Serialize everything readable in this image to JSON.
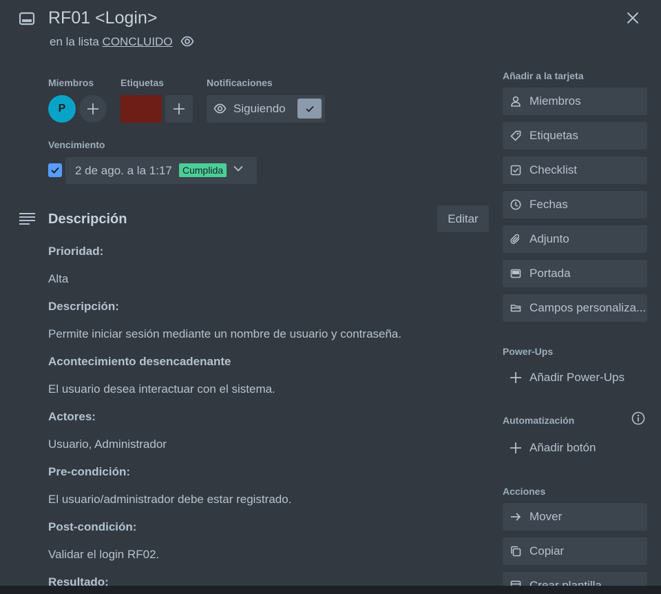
{
  "header": {
    "title": "RF01 <Login>",
    "list_prefix": "en la lista ",
    "list_name": "CONCLUIDO"
  },
  "members": {
    "label": "Miembros",
    "avatar_initial": "P"
  },
  "labels": {
    "label": "Etiquetas",
    "chip_color": "#6e1e17"
  },
  "notifications": {
    "label": "Notificaciones",
    "button_label": "Siguiendo"
  },
  "due": {
    "label": "Vencimiento",
    "date_text": "2 de ago. a la 1:17",
    "status_badge": "Cumplida",
    "completed": true
  },
  "description": {
    "title": "Descripción",
    "edit_label": "Editar",
    "lines": [
      {
        "text": "Prioridad:",
        "bold": true
      },
      {
        "text": "Alta",
        "bold": false
      },
      {
        "text": "Descripción:",
        "bold": true
      },
      {
        "text": "Permite iniciar sesión mediante un nombre de usuario y contraseña.",
        "bold": false
      },
      {
        "text": "Acontecimiento desencadenante",
        "bold": true
      },
      {
        "text": "El usuario desea interactuar con el sistema.",
        "bold": false
      },
      {
        "text": "Actores:",
        "bold": true
      },
      {
        "text": "Usuario, Administrador",
        "bold": false
      },
      {
        "text": "Pre-condición:",
        "bold": true
      },
      {
        "text": "El usuario/administrador debe estar registrado.",
        "bold": false
      },
      {
        "text": "Post-condición:",
        "bold": true
      },
      {
        "text": "Validar el login RF02.",
        "bold": false
      },
      {
        "text": "Resultado:",
        "bold": true
      }
    ]
  },
  "sidebar": {
    "add_to_card_label": "Añadir a la tarjeta",
    "add_items": [
      {
        "label": "Miembros",
        "icon": "person-icon"
      },
      {
        "label": "Etiquetas",
        "icon": "tag-icon"
      },
      {
        "label": "Checklist",
        "icon": "checklist-icon"
      },
      {
        "label": "Fechas",
        "icon": "clock-icon"
      },
      {
        "label": "Adjunto",
        "icon": "paperclip-icon"
      },
      {
        "label": "Portada",
        "icon": "cover-icon"
      },
      {
        "label": "Campos personaliza...",
        "icon": "custom-fields-icon"
      }
    ],
    "powerups_label": "Power-Ups",
    "add_powerups": "Añadir Power-Ups",
    "automation_label": "Automatización",
    "add_button": "Añadir botón",
    "actions_label": "Acciones",
    "action_items": [
      {
        "label": "Mover",
        "icon": "arrow-right-icon"
      },
      {
        "label": "Copiar",
        "icon": "copy-icon"
      },
      {
        "label": "Crear plantilla",
        "icon": "template-icon"
      }
    ]
  },
  "colors": {
    "background": "#323940",
    "button": "#3c444d",
    "avatar": "#0aa3c8",
    "badge_done": "#4bce97",
    "checkbox": "#579dff"
  }
}
